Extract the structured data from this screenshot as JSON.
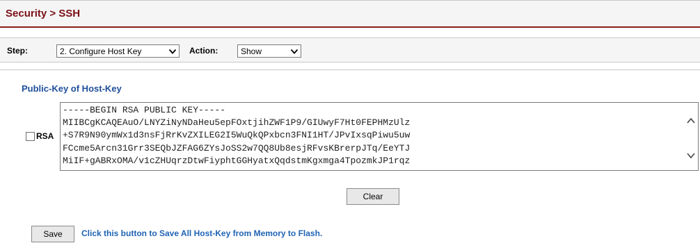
{
  "header": {
    "title": "Security > SSH"
  },
  "toolbar": {
    "step_label": "Step:",
    "step_value": "2. Configure Host Key",
    "action_label": "Action:",
    "action_value": "Show"
  },
  "section": {
    "heading": "Public-Key of Host-Key"
  },
  "rsa": {
    "label": "RSA",
    "checked": false,
    "key_text": "-----BEGIN RSA PUBLIC KEY-----\nMIIBCgKCAQEAuO/LNYZiNyNDaHeu5epFOxtjihZWF1P9/GIUwyF7Ht0FEPHMzUlz\n+S7R9N90ymWx1d3nsFjRrKvZXILEG2I5WuQkQPxbcn3FNI1HT/JPvIxsqPiwu5uw\nFCcme5Arcn31Grr3SEQbJZFAG6ZYsJoSS2w7QQ8Ub8esjRFvsKBrerpJTq/EeYTJ\nMiIF+gABRxOMA/v1cZHUqrzDtwFiyphtGGHyatxQqdstmKgxmga4TpozmkJP1rqz"
  },
  "buttons": {
    "clear": "Clear",
    "save": "Save"
  },
  "save_hint": "Click this button to Save All Host-Key from Memory to Flash.",
  "colors": {
    "title": "#7b0f16",
    "heading": "#1f4e9c",
    "hint": "#1f63b5",
    "title_rule": "#8b1c1c"
  }
}
